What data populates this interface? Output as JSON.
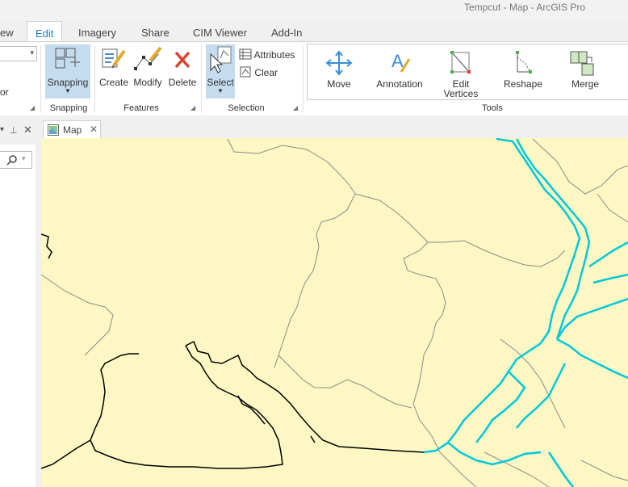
{
  "app": {
    "title": "Tempcut - Map - ArcGIS Pro"
  },
  "tabs": [
    {
      "label": "ew"
    },
    {
      "label": "Edit"
    },
    {
      "label": "Imagery"
    },
    {
      "label": "Share"
    },
    {
      "label": "CIM Viewer"
    },
    {
      "label": "Add-In"
    }
  ],
  "ribbon": {
    "left_partial": "or",
    "snapping": {
      "button": "Snapping",
      "group": "Snapping"
    },
    "features": {
      "create": "Create",
      "modify": "Modify",
      "delete": "Delete",
      "group": "Features"
    },
    "selection": {
      "select": "Select",
      "attributes": "Attributes",
      "clear": "Clear",
      "group": "Selection"
    },
    "tools": {
      "move": "Move",
      "annotation": "Annotation",
      "edit_vertices_1": "Edit",
      "edit_vertices_2": "Vertices",
      "reshape": "Reshape",
      "merge": "Merge",
      "group": "Tools"
    }
  },
  "map_view": {
    "tab_label": "Map"
  },
  "colors": {
    "map_background": "#fcf7c3",
    "accent": "#1a7bc4",
    "river": "#00c8dc",
    "selected_button": "#c5dcef"
  }
}
